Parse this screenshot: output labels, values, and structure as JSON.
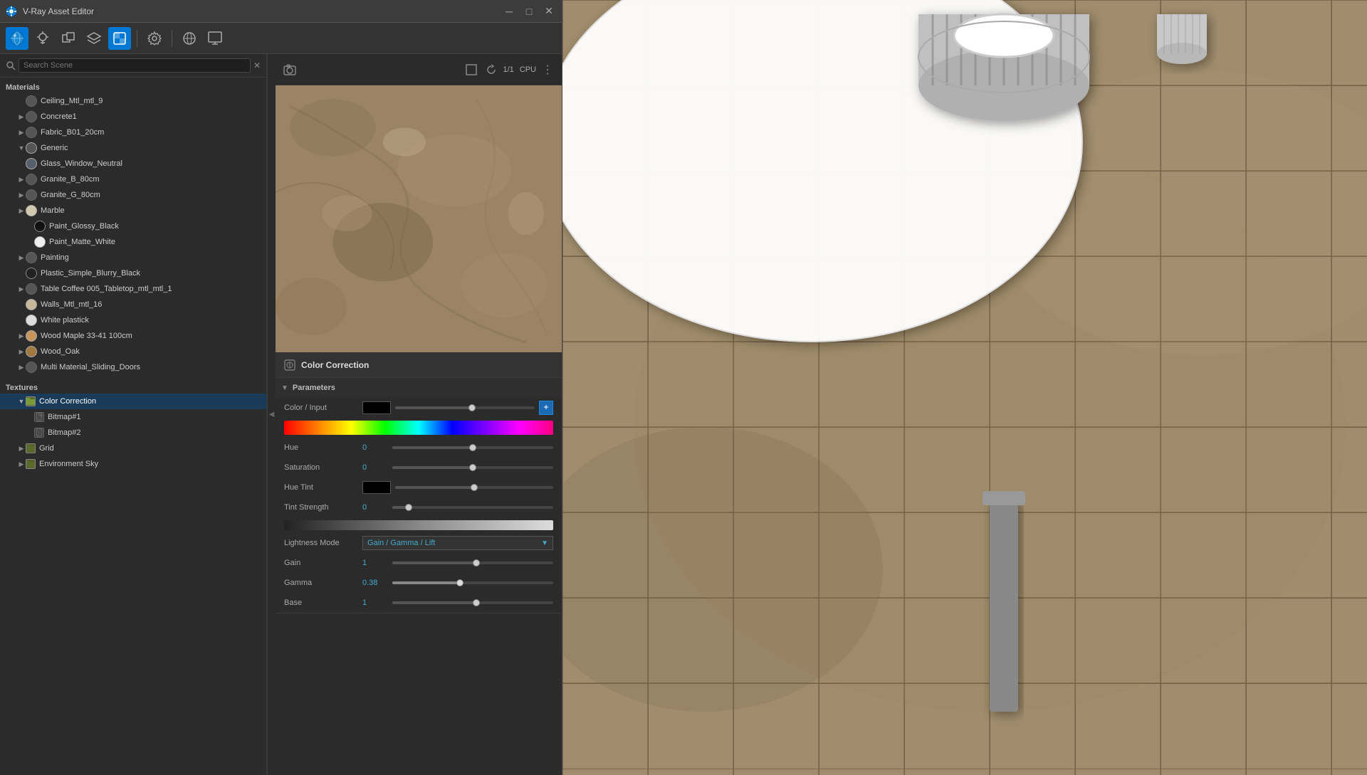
{
  "window": {
    "title": "V-Ray Asset Editor",
    "minimize_label": "─",
    "maximize_label": "□",
    "close_label": "✕"
  },
  "toolbar": {
    "icons": [
      "vray-icon",
      "light-icon",
      "geometry-icon",
      "layers-icon",
      "texture-icon",
      "settings-icon",
      "sep",
      "material-icon",
      "render-icon"
    ]
  },
  "search": {
    "placeholder": "Search Scene",
    "clear_icon": "✕"
  },
  "materials_section": {
    "header": "Materials",
    "items": [
      {
        "label": "Ceiling_Mtl_mtl_9",
        "indent": 1,
        "has_arrow": false
      },
      {
        "label": "Concrete1",
        "indent": 1,
        "has_arrow": true
      },
      {
        "label": "Fabric_B01_20cm",
        "indent": 1,
        "has_arrow": true
      },
      {
        "label": "Generic",
        "indent": 1,
        "has_arrow": true,
        "expanded": true
      },
      {
        "label": "Glass_Window_Neutral",
        "indent": 1,
        "has_arrow": false
      },
      {
        "label": "Granite_B_80cm",
        "indent": 1,
        "has_arrow": true
      },
      {
        "label": "Granite_G_80cm",
        "indent": 1,
        "has_arrow": true
      },
      {
        "label": "Marble",
        "indent": 1,
        "has_arrow": true
      },
      {
        "label": "Paint_Glossy_Black",
        "indent": 2,
        "has_arrow": false
      },
      {
        "label": "Paint_Matte_White",
        "indent": 2,
        "has_arrow": false
      },
      {
        "label": "Painting",
        "indent": 1,
        "has_arrow": true
      },
      {
        "label": "Plastic_Simple_Blurry_Black",
        "indent": 1,
        "has_arrow": false
      },
      {
        "label": "Table Coffee 005_Tabletop_mtl_mtl_1",
        "indent": 1,
        "has_arrow": true
      },
      {
        "label": "Walls_Mtl_mtl_16",
        "indent": 1,
        "has_arrow": false
      },
      {
        "label": "White plastick",
        "indent": 1,
        "has_arrow": false
      },
      {
        "label": "Wood Maple 33-41 100cm",
        "indent": 1,
        "has_arrow": true
      },
      {
        "label": "Wood_Oak",
        "indent": 1,
        "has_arrow": true
      },
      {
        "label": "Multi Material_Sliding_Doors",
        "indent": 1,
        "has_arrow": true
      }
    ]
  },
  "textures_section": {
    "header": "Textures",
    "items": [
      {
        "label": "Color Correction",
        "indent": 1,
        "has_arrow": true,
        "expanded": true,
        "active": true,
        "icon_type": "folder"
      },
      {
        "label": "Bitmap#1",
        "indent": 2,
        "has_arrow": false,
        "icon_type": "file"
      },
      {
        "label": "Bitmap#2",
        "indent": 2,
        "has_arrow": false,
        "icon_type": "file"
      },
      {
        "label": "Grid",
        "indent": 1,
        "has_arrow": true,
        "icon_type": "folder"
      },
      {
        "label": "Environment Sky",
        "indent": 1,
        "has_arrow": true,
        "icon_type": "folder"
      }
    ]
  },
  "preview": {
    "render_icon": "camera-icon",
    "refresh_icon": "refresh-icon",
    "ratio_text": "1/1",
    "cpu_text": "CPU",
    "menu_icon": "dots-menu-icon"
  },
  "color_correction": {
    "title": "Color Correction",
    "icon": "color-correction-icon"
  },
  "parameters": {
    "section_title": "Parameters",
    "fields": [
      {
        "name": "color_input",
        "label": "Color / Input",
        "type": "color_with_slider",
        "swatch_color": "#000000",
        "slider_pos": 0.55,
        "has_color_btn": true,
        "color_btn_color": "#1a6ab5"
      },
      {
        "name": "hue",
        "label": "Hue",
        "type": "slider",
        "value": "0",
        "value_color": "#4ac",
        "slider_pos": 0.5
      },
      {
        "name": "saturation",
        "label": "Saturation",
        "type": "slider",
        "value": "0",
        "value_color": "#4ac",
        "slider_pos": 0.5
      },
      {
        "name": "hue_tint",
        "label": "Hue Tint",
        "type": "color_slider",
        "swatch_color": "#000000",
        "slider_pos": 0.5
      },
      {
        "name": "tint_strength",
        "label": "Tint Strength",
        "type": "slider",
        "value": "0",
        "value_color": "#4ac",
        "slider_pos": 0.1
      }
    ],
    "lightness_mode": {
      "label": "Lightness Mode",
      "value": "Gain / Gamma / Lift",
      "value_color": "#4ac"
    },
    "lightness_fields": [
      {
        "name": "gain",
        "label": "Gain",
        "value": "1",
        "value_color": "#4ac",
        "slider_pos": 0.52
      },
      {
        "name": "gamma",
        "label": "Gamma",
        "value": "0.38",
        "value_color": "#4ac",
        "slider_pos": 0.42
      },
      {
        "name": "base",
        "label": "Base",
        "value": "1",
        "value_color": "#4ac",
        "slider_pos": 0.52
      }
    ]
  },
  "viewport": {
    "background_color": "#8b7a5e"
  }
}
